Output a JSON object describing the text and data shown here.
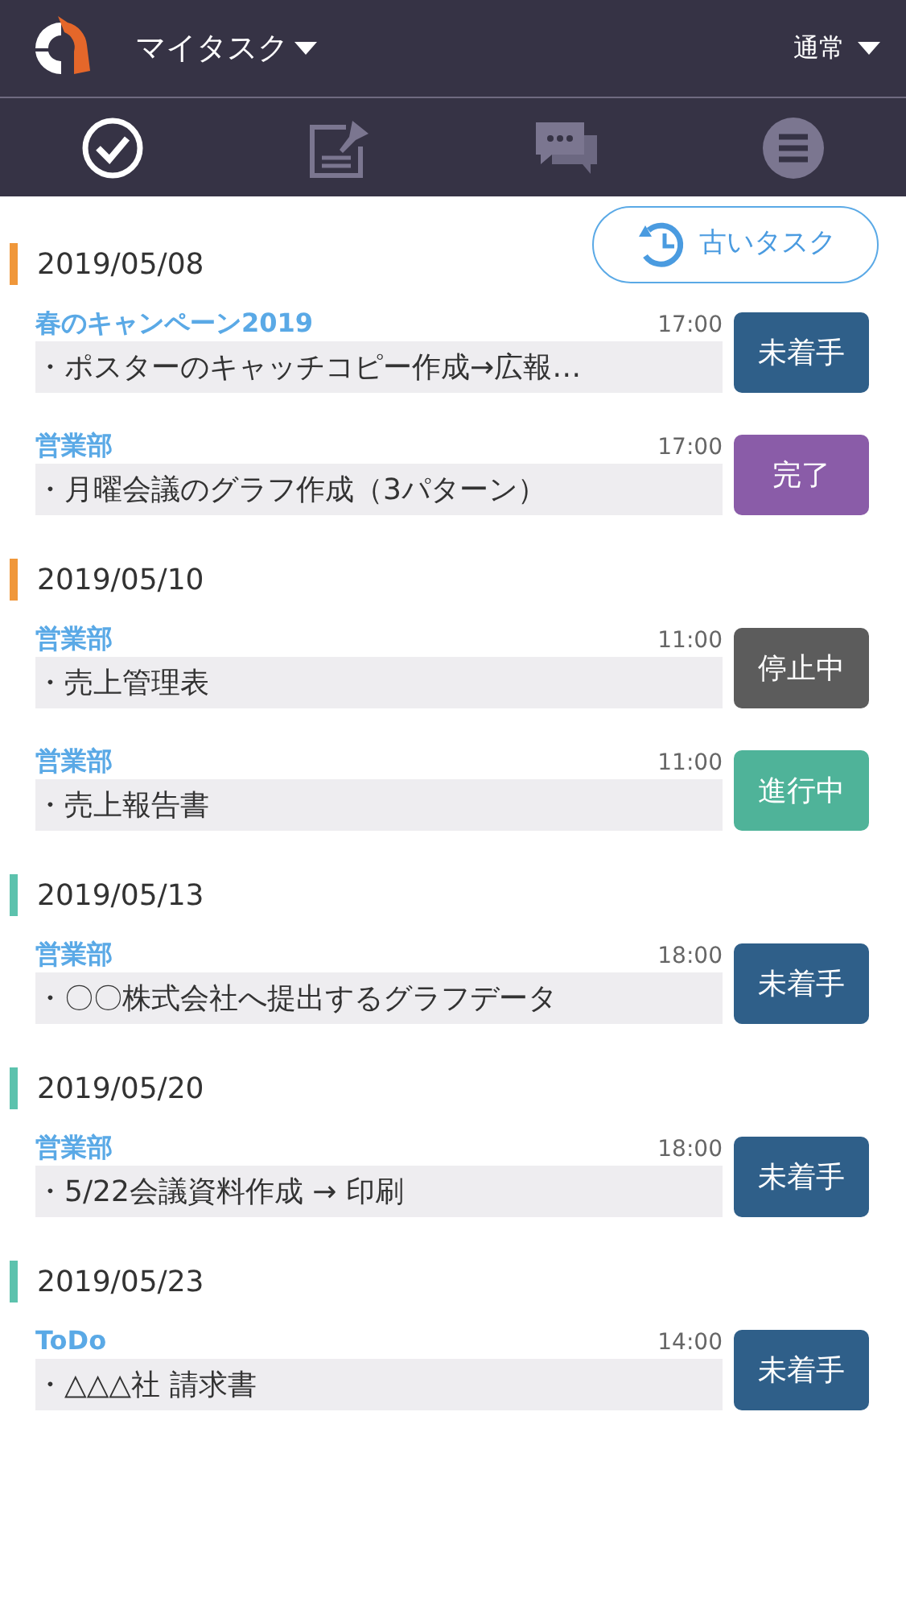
{
  "header": {
    "title": "マイタスク",
    "mode": "通常"
  },
  "tabs": [
    {
      "kind": "check",
      "selected": true
    },
    {
      "kind": "note",
      "selected": false
    },
    {
      "kind": "chat",
      "selected": false
    },
    {
      "kind": "menu",
      "selected": false
    }
  ],
  "old_tasks_button": "古いタスク",
  "groups": [
    {
      "date": "2019/05/08",
      "color": "#f0973a",
      "tasks": [
        {
          "project": "春のキャンペーン2019",
          "time": "17:00",
          "text": "・ポスターのキャッチコピー作成→広報…",
          "status": "未着手",
          "kind": "not_started"
        },
        {
          "project": "営業部",
          "time": "17:00",
          "text": "・月曜会議のグラフ作成（3パターン）",
          "status": "完了",
          "kind": "done"
        }
      ]
    },
    {
      "date": "2019/05/10",
      "color": "#f0973a",
      "tasks": [
        {
          "project": "営業部",
          "time": "11:00",
          "text": "・売上管理表",
          "status": "停止中",
          "kind": "stopped"
        },
        {
          "project": "営業部",
          "time": "11:00",
          "text": "・売上報告書",
          "status": "進行中",
          "kind": "in_progress"
        }
      ]
    },
    {
      "date": "2019/05/13",
      "color": "#5cc2ad",
      "tasks": [
        {
          "project": "営業部",
          "time": "18:00",
          "text": "・〇〇株式会社へ提出するグラフデータ",
          "status": "未着手",
          "kind": "not_started"
        }
      ]
    },
    {
      "date": "2019/05/20",
      "color": "#5cc2ad",
      "tasks": [
        {
          "project": "営業部",
          "time": "18:00",
          "text": "・5/22会議資料作成 → 印刷",
          "status": "未着手",
          "kind": "not_started"
        }
      ]
    },
    {
      "date": "2019/05/23",
      "color": "#5cc2ad",
      "tasks": [
        {
          "project": "ToDo",
          "time": "14:00",
          "text": "・△△△社 請求書",
          "status": "未着手",
          "kind": "not_started"
        }
      ]
    }
  ]
}
